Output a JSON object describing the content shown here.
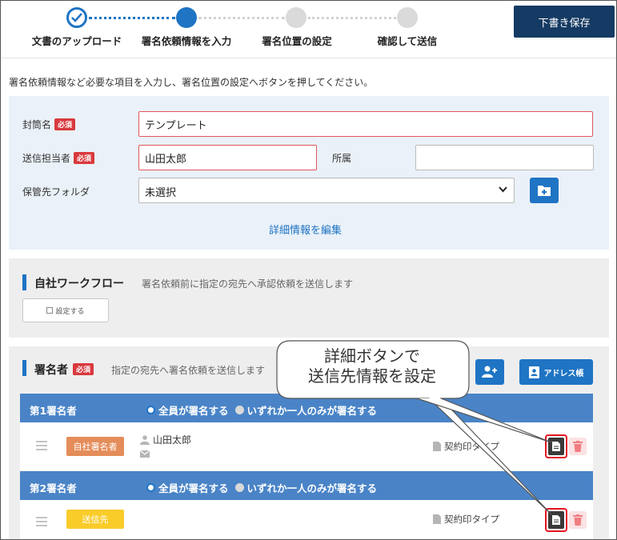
{
  "stepper": {
    "steps": [
      {
        "label": "文書のアップロード",
        "state": "done"
      },
      {
        "label": "署名依頼情報を入力",
        "state": "active"
      },
      {
        "label": "署名位置の設定",
        "state": "todo"
      },
      {
        "label": "確認して送信",
        "state": "todo"
      }
    ],
    "save_label": "下書き保存"
  },
  "intro_text": "署名依頼情報など必要な項目を入力し、署名位置の設定へボタンを押してください。",
  "form": {
    "required_badge": "必須",
    "envelope": {
      "label": "封筒名",
      "value": "テンプレート"
    },
    "sender": {
      "label": "送信担当者",
      "value": "山田太郎"
    },
    "affiliation": {
      "label": "所属",
      "value": ""
    },
    "folder": {
      "label": "保管先フォルダ",
      "selected": "未選択"
    },
    "edit_details_label": "詳細情報を編集"
  },
  "workflow": {
    "title": "自社ワークフロー",
    "description": "署名依頼前に指定の宛先へ承認依頼を送信します",
    "setting_button": "設定する"
  },
  "signers": {
    "title": "署名者",
    "required_badge": "必須",
    "description": "指定の宛先へ署名依頼を送信します",
    "address_book_label": "アドレス帳",
    "groups": [
      {
        "title": "第1署名者",
        "option_all": "全員が署名する",
        "option_any": "いずれか一人のみが署名する",
        "signer": {
          "type_label": "自社署名者",
          "name": "山田太郎",
          "doc_type": "契約印タイプ"
        }
      },
      {
        "title": "第2署名者",
        "option_all": "全員が署名する",
        "option_any": "いずれか一人のみが署名する",
        "signer": {
          "type_label": "送信先",
          "name": "",
          "doc_type": "契約印タイプ"
        }
      }
    ]
  },
  "callout": {
    "line1": "詳細ボタンで",
    "line2": "送信先情報を設定"
  },
  "colors": {
    "accent": "#1f74c4",
    "navy": "#153a63",
    "required": "#d9393d",
    "group_header": "#4a84c7",
    "highlight": "#e3141f"
  }
}
